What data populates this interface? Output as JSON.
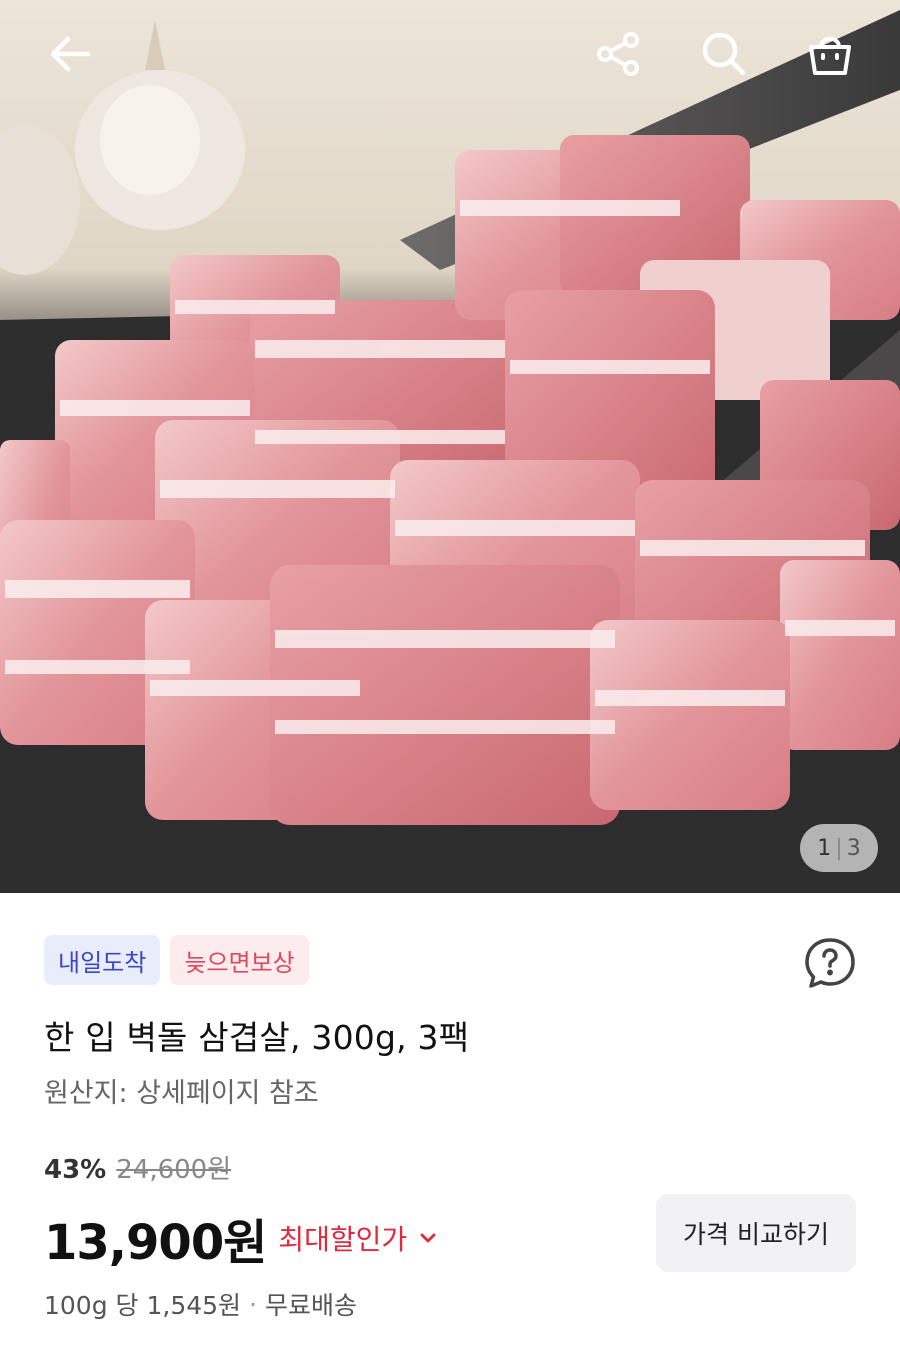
{
  "header": {
    "back_icon": "arrow-left-icon",
    "share_icon": "share-icon",
    "search_icon": "search-icon",
    "cart_icon": "shopping-bag-icon"
  },
  "gallery": {
    "current": "1",
    "separator": "|",
    "total": "3"
  },
  "badges": {
    "arrival": "내일도착",
    "late_compensation": "늦으면보상"
  },
  "product": {
    "title": "한 입 벽돌 삼겹살, 300g, 3팩",
    "origin": "원산지: 상세페이지 참조"
  },
  "pricing": {
    "discount_rate": "43%",
    "original_price": "24,600원",
    "sale_price": "13,900원",
    "max_discount_label": "최대할인가",
    "compare_button": "가격 비교하기",
    "unit_price": "100g 당 1,545원",
    "separator": "·",
    "shipping": "무료배송"
  },
  "colors": {
    "accent_red": "#e0293b",
    "badge_blue_text": "#3b47c4",
    "badge_blue_bg": "#e8ecfb",
    "badge_pink_text": "#e0485b",
    "badge_pink_bg": "#fdeced"
  }
}
